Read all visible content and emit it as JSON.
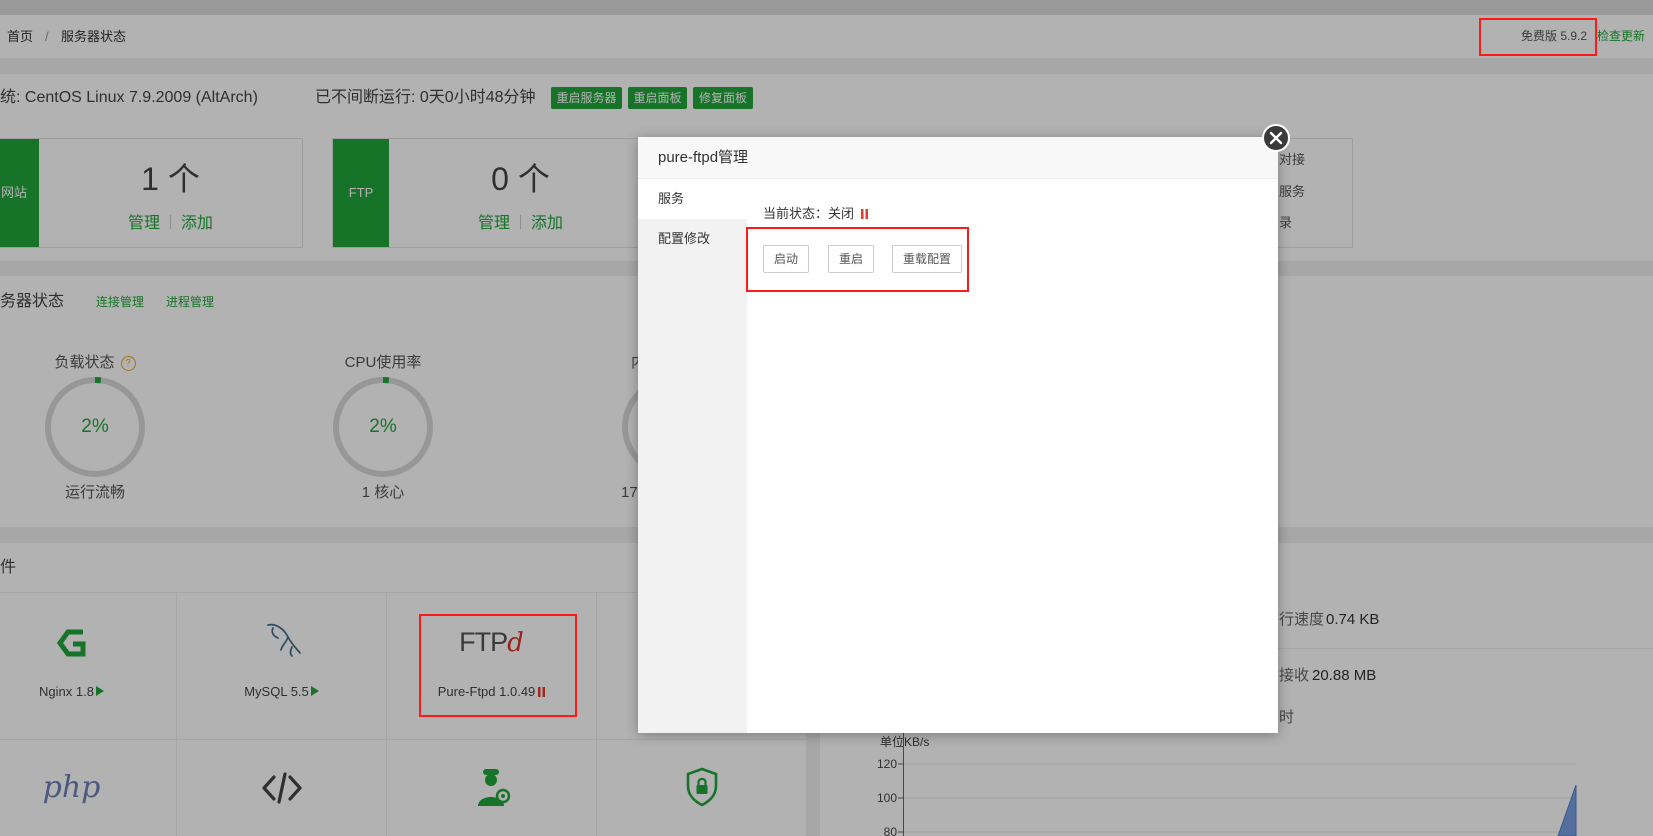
{
  "breadcrumb": {
    "home": "首页",
    "separator": "/",
    "current": "服务器状态"
  },
  "header": {
    "version": "免费版 5.9.2",
    "check_update": "检查更新"
  },
  "system": {
    "os": "统: CentOS Linux 7.9.2009 (AltArch)",
    "uptime": "已不间断运行: 0天0小时48分钟",
    "buttons": [
      "重启服务器",
      "重启面板",
      "修复面板"
    ]
  },
  "overview": {
    "cards": [
      {
        "label": "网站",
        "count": "1 个",
        "manage": "管理",
        "add": "添加"
      },
      {
        "label": "FTP",
        "count": "0 个",
        "manage": "管理",
        "add": "添加"
      }
    ],
    "side_items": [
      "对接",
      "服务",
      "录"
    ]
  },
  "status": {
    "title": "务器状态",
    "links": [
      "连接管理",
      "进程管理"
    ],
    "gauges": [
      {
        "label": "负载状态",
        "value": "2%",
        "percent": 2,
        "caption": "运行流畅",
        "help_icon": "help-icon"
      },
      {
        "label": "CPU使用率",
        "value": "2%",
        "percent": 2,
        "caption": "1 核心"
      },
      {
        "label": "内",
        "caption": "17"
      }
    ]
  },
  "software": {
    "title": "件",
    "items": [
      {
        "name": "Nginx 1.8",
        "icon": "nginx-icon",
        "status_icon": "play-icon"
      },
      {
        "name": "MySQL 5.5",
        "icon": "mysql-dolphin-icon",
        "status_icon": "play-icon"
      },
      {
        "name": "Pure-Ftpd 1.0.49",
        "icon": "ftpd-logo",
        "logo": [
          "FTP",
          "d"
        ],
        "status_icon": "pause-icon"
      },
      {
        "icon": "php-logo",
        "logo": "php"
      },
      {
        "icon": "code-icon"
      },
      {
        "icon": "ops-engineer-icon"
      },
      {
        "icon": "security-shield-icon"
      }
    ]
  },
  "traffic": {
    "speed_label": "行速度",
    "speed": "0.74 KB",
    "recv_label": "接收",
    "recv": "20.88 MB",
    "time_label": "时",
    "unit": "单位KB/s",
    "yticks": [
      "120",
      "100",
      "80"
    ]
  },
  "modal": {
    "title": "pure-ftpd管理",
    "nav": [
      "服务",
      "配置修改"
    ],
    "status_label": "当前状态：",
    "status_value": "关闭",
    "status_icon": "pause-icon",
    "buttons": [
      "启动",
      "重启",
      "重载配置"
    ],
    "close_icon": "close-icon"
  },
  "colors": {
    "accent": "#20a53a",
    "danger": "#e03d2f",
    "annotation": "#ff1a1a",
    "overlay": "rgba(0,0,0,0.3)"
  }
}
